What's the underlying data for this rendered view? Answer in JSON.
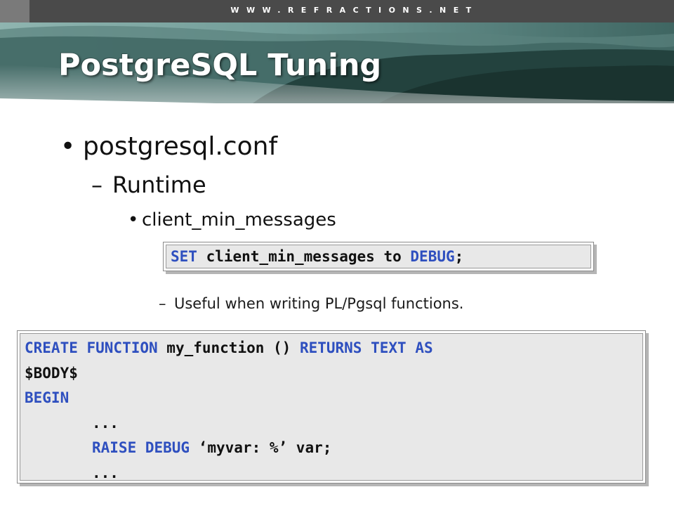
{
  "header": {
    "url": "WWW.REFRACTIONS.NET"
  },
  "slide": {
    "title": "PostgreSQL Tuning",
    "bullet1": "postgresql.conf",
    "sub1": "Runtime",
    "subsub1": "client_min_messages",
    "note": "Useful when writing PL/Pgsql functions."
  },
  "code1": {
    "kw_set": "SET",
    "ident": " client_min_messages ",
    "kw_to": "to",
    "space": " ",
    "kw_debug": "DEBUG",
    "end": ";"
  },
  "code2": {
    "l1_kw1": "CREATE FUNCTION",
    "l1_txt": " my_function () ",
    "l1_kw2": "RETURNS TEXT AS",
    "l2_txt": "$BODY$",
    "l3_kw": "BEGIN",
    "l4_txt": "...",
    "l5_kw": "RAISE DEBUG",
    "l5_txt": " ‘myvar: %’ var;",
    "l6_txt": "..."
  },
  "colors": {
    "keyword": "#2e4fbf",
    "top_bar": "#4a4a4a",
    "code_bg": "#e8e8e8"
  }
}
